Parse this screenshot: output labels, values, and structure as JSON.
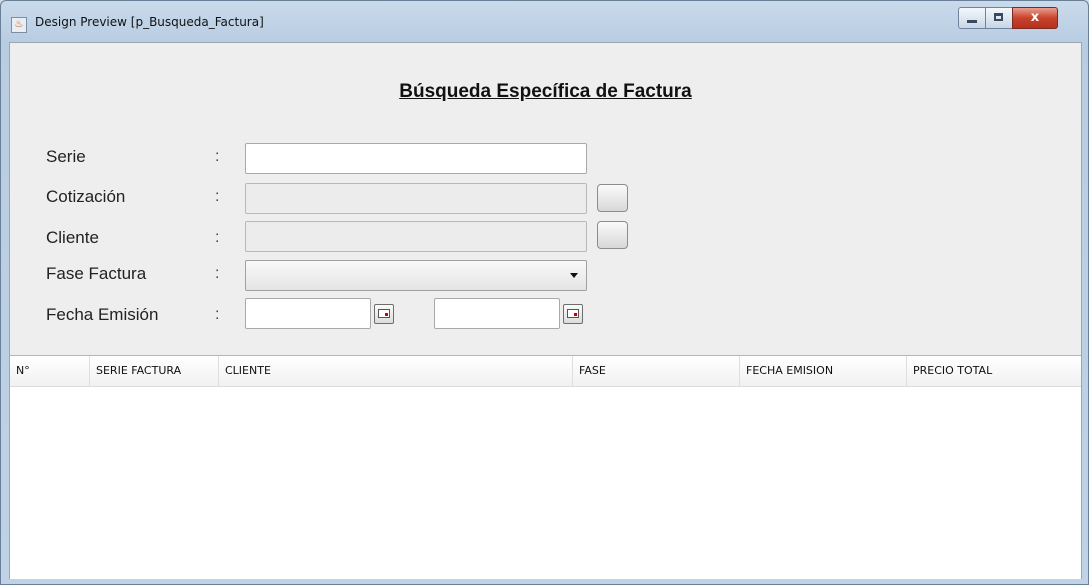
{
  "window": {
    "title": "Design Preview [p_Busqueda_Factura]",
    "close_glyph": "x"
  },
  "form": {
    "heading": "Búsqueda Específica de Factura",
    "separator": ":",
    "fields": [
      {
        "label": "Serie",
        "value": "",
        "enabled": true
      },
      {
        "label": "Cotización",
        "value": "",
        "enabled": false
      },
      {
        "label": "Cliente",
        "value": "",
        "enabled": false
      },
      {
        "label": "Fase Factura",
        "value": ""
      },
      {
        "label": "Fecha Emisión",
        "from": "",
        "to": ""
      }
    ]
  },
  "table": {
    "columns": [
      "N°",
      "SERIE FACTURA",
      "CLIENTE",
      "FASE",
      "FECHA EMISION",
      "PRECIO TOTAL"
    ],
    "rows": []
  },
  "icons": {
    "window": "java-app-icon",
    "lookup": "ellipsis-button",
    "date": "calendar-icon",
    "combo": "chevron-down-icon"
  },
  "colors": {
    "title_bar": "#bfd2e6",
    "panel": "#eeeeee",
    "close_button": "#c8422c"
  }
}
